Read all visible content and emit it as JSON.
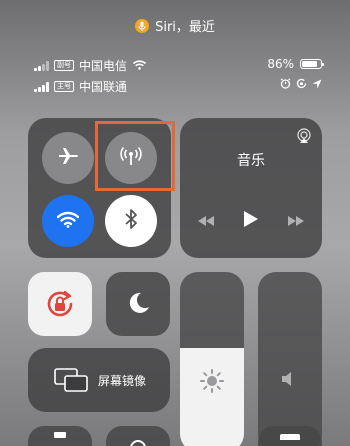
{
  "siri_banner": {
    "text": "Siri，最近"
  },
  "status": {
    "sim1": {
      "tag": "副号",
      "carrier": "中国电信"
    },
    "sim2": {
      "tag": "主号",
      "carrier": "中国联通"
    },
    "battery_percent": "86%",
    "battery_level": 0.86
  },
  "connectivity": {
    "airplane": "airplane-icon",
    "cellular": "cellular-antenna-icon",
    "wifi": "wifi-icon",
    "bluetooth": "bluetooth-icon"
  },
  "music": {
    "title": "音乐"
  },
  "screen_mirroring": {
    "label": "屏幕镜像"
  },
  "brightness_level": 0.25,
  "volume_level": 0.0,
  "colors": {
    "accent_blue": "#1f72f0",
    "highlight_box": "#e2693a",
    "orientation_lock_red": "#e0463d"
  }
}
